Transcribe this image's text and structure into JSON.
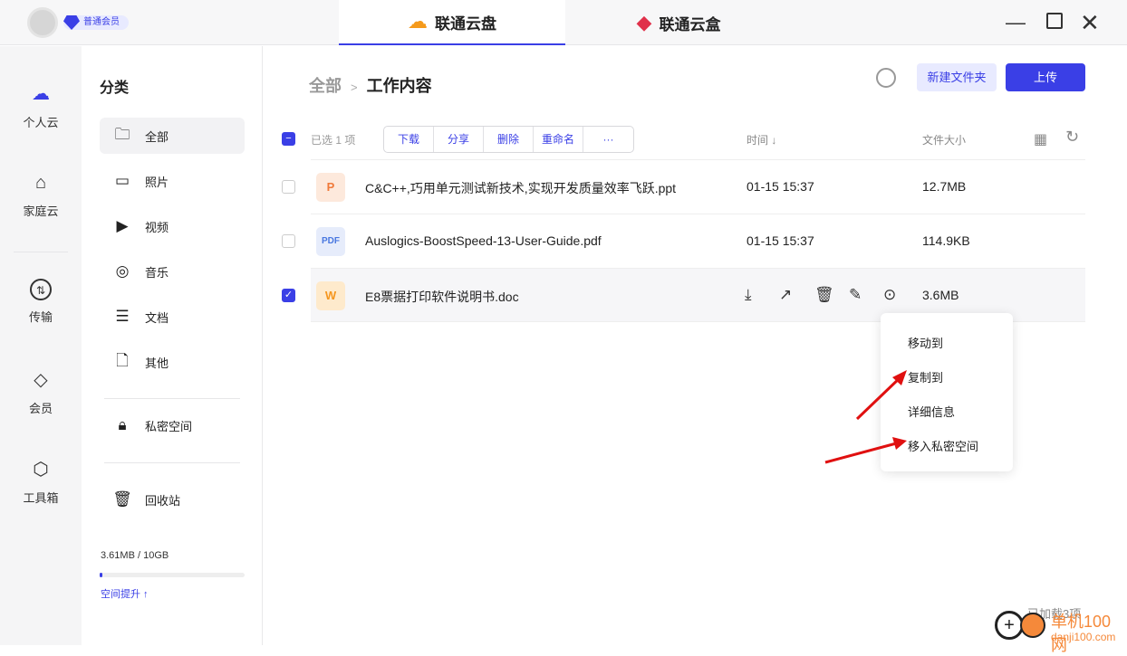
{
  "top": {
    "member_badge": "普通会员",
    "tabs": [
      {
        "label": "联通云盘",
        "active": true
      },
      {
        "label": "联通云盒",
        "active": false
      }
    ]
  },
  "nav": [
    {
      "label": "个人云",
      "icon": "cloud-icon"
    },
    {
      "label": "家庭云",
      "icon": "home-icon"
    },
    {
      "label": "传输",
      "icon": "transfer-icon"
    },
    {
      "label": "会员",
      "icon": "diamond-icon"
    },
    {
      "label": "工具箱",
      "icon": "toolbox-icon"
    }
  ],
  "category": {
    "title": "分类",
    "items": [
      {
        "label": "全部",
        "icon": "folder-icon"
      },
      {
        "label": "照片",
        "icon": "image-icon"
      },
      {
        "label": "视频",
        "icon": "video-icon"
      },
      {
        "label": "音乐",
        "icon": "music-icon"
      },
      {
        "label": "文档",
        "icon": "document-icon"
      },
      {
        "label": "其他",
        "icon": "file-icon"
      }
    ],
    "private": "私密空间",
    "recycle": "回收站",
    "storage": "3.61MB / 10GB",
    "storage_fraction": 0.00035,
    "upgrade": "空间提升 ↑"
  },
  "main": {
    "crumb_root": "全部",
    "crumb_sep": ">",
    "crumb_current": "工作内容",
    "new_folder": "新建文件夹",
    "upload": "上传",
    "selected": "已选 1 项",
    "actions": [
      "下载",
      "分享",
      "删除",
      "重命名",
      "···"
    ],
    "col_time": "时间 ↓",
    "col_size": "文件大小",
    "files": [
      {
        "type": "P",
        "name": "C&C++,巧用单元测试新技术,实现开发质量效率飞跃.ppt",
        "time": "01-15 15:37",
        "size": "12.7MB",
        "checked": false
      },
      {
        "type": "PDF",
        "name": "Auslogics-BoostSpeed-13-User-Guide.pdf",
        "time": "01-15 15:37",
        "size": "114.9KB",
        "checked": false
      },
      {
        "type": "W",
        "name": "E8票据打印软件说明书.doc",
        "time": "",
        "size": "3.6MB",
        "checked": true
      }
    ],
    "context_menu": [
      "移动到",
      "复制到",
      "详细信息",
      "移入私密空间"
    ],
    "loaded": "已加载3项"
  },
  "watermark": "单机100网 danji100.com",
  "colors": {
    "accent": "#3a3fe6"
  }
}
